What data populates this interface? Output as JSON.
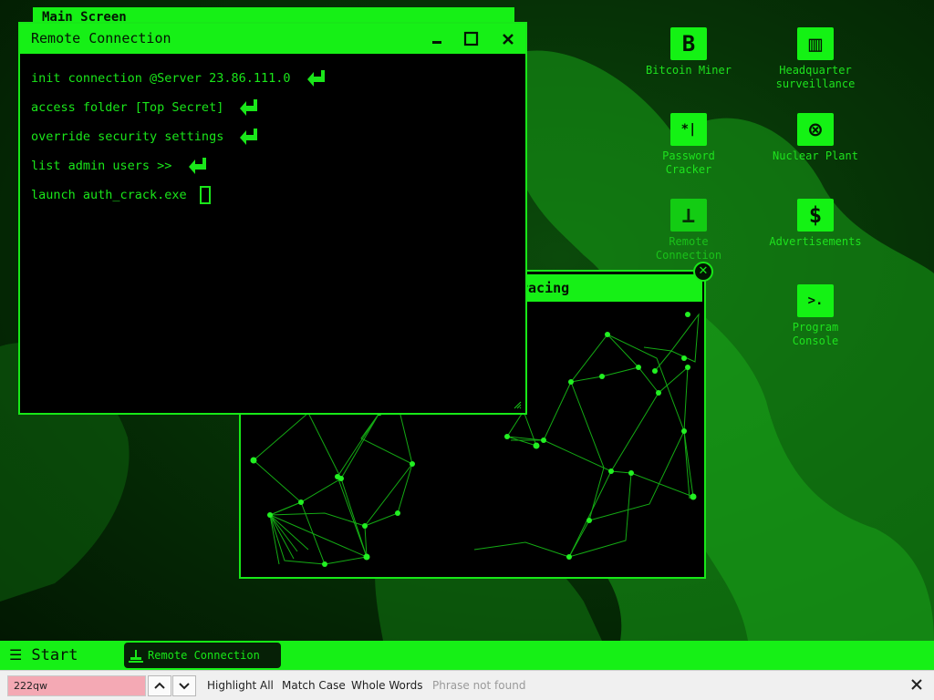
{
  "background_windows": {
    "ghost_title": "Main Screen"
  },
  "remote_window": {
    "title": "Remote Connection",
    "lines": [
      "init connection @Server 23.86.111.0",
      "access folder [Top Secret]",
      "override security settings",
      "list admin users >>",
      "launch auth_crack.exe"
    ]
  },
  "trace_window": {
    "title": "IP Tracing",
    "visible_title_fragment": "racing"
  },
  "desktop_icons": [
    {
      "id": "bitcoin-miner",
      "glyph": "B",
      "label": "Bitcoin Miner"
    },
    {
      "id": "headquarter-surveillance",
      "glyph": "▥",
      "label": "Headquarter\nsurveillance"
    },
    {
      "id": "password-cracker",
      "glyph": "*|",
      "label": "Password\nCracker"
    },
    {
      "id": "nuclear-plant",
      "glyph": "⊗",
      "label": "Nuclear Plant"
    },
    {
      "id": "remote-connection",
      "glyph": "⊥",
      "label": "Remote\nConnection"
    },
    {
      "id": "advertisements",
      "glyph": "$",
      "label": "Advertisements"
    },
    {
      "id": "program-console",
      "glyph": ">.",
      "label": "Program\nConsole"
    }
  ],
  "taskbar": {
    "start_label": "Start",
    "task_label": "Remote Connection"
  },
  "findbar": {
    "query": "222qw",
    "highlight_all": "Highlight All",
    "match_case": "Match Case",
    "whole_words": "Whole Words",
    "status": "Phrase not found"
  },
  "colors": {
    "accent": "#16f016",
    "terminal_text": "#1ae61a",
    "window_bg": "#000000",
    "find_not_found": "#f4a9b4"
  }
}
